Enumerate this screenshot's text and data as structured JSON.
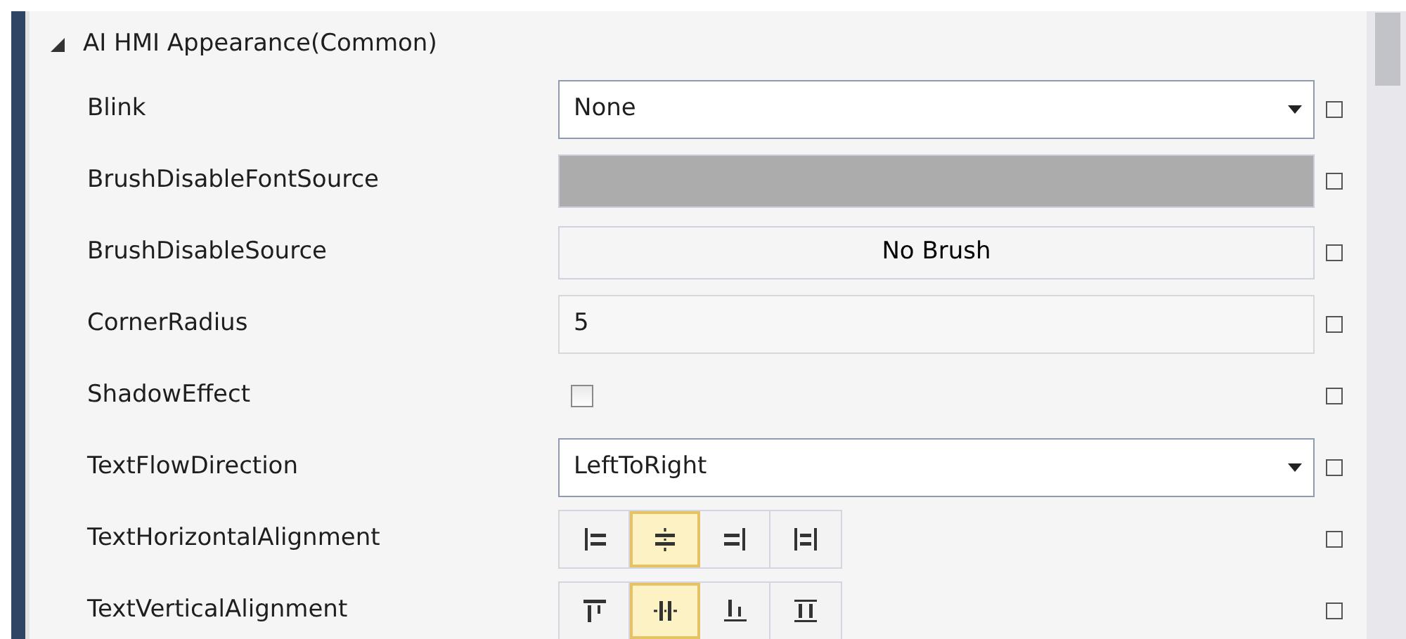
{
  "section": {
    "title": "AI HMI Appearance(Common)",
    "expanded": true
  },
  "properties": [
    {
      "name": "Blink",
      "kind": "dropdown",
      "value": "None"
    },
    {
      "name": "BrushDisableFontSource",
      "kind": "color",
      "color": "#acacac"
    },
    {
      "name": "BrushDisableSource",
      "kind": "brush",
      "value": "No Brush"
    },
    {
      "name": "CornerRadius",
      "kind": "text",
      "value": "5"
    },
    {
      "name": "ShadowEffect",
      "kind": "checkbox",
      "checked": false
    },
    {
      "name": "TextFlowDirection",
      "kind": "dropdown",
      "value": "LeftToRight"
    },
    {
      "name": "TextHorizontalAlignment",
      "kind": "alignment",
      "options": [
        {
          "kind": "left",
          "selected": false
        },
        {
          "kind": "center",
          "selected": true
        },
        {
          "kind": "right",
          "selected": false
        },
        {
          "kind": "stretch",
          "selected": false
        }
      ]
    },
    {
      "name": "TextVerticalAlignment",
      "kind": "alignment",
      "options": [
        {
          "kind": "top",
          "selected": false
        },
        {
          "kind": "middle",
          "selected": true
        },
        {
          "kind": "bottom",
          "selected": false
        },
        {
          "kind": "fill",
          "selected": false
        }
      ]
    }
  ]
}
